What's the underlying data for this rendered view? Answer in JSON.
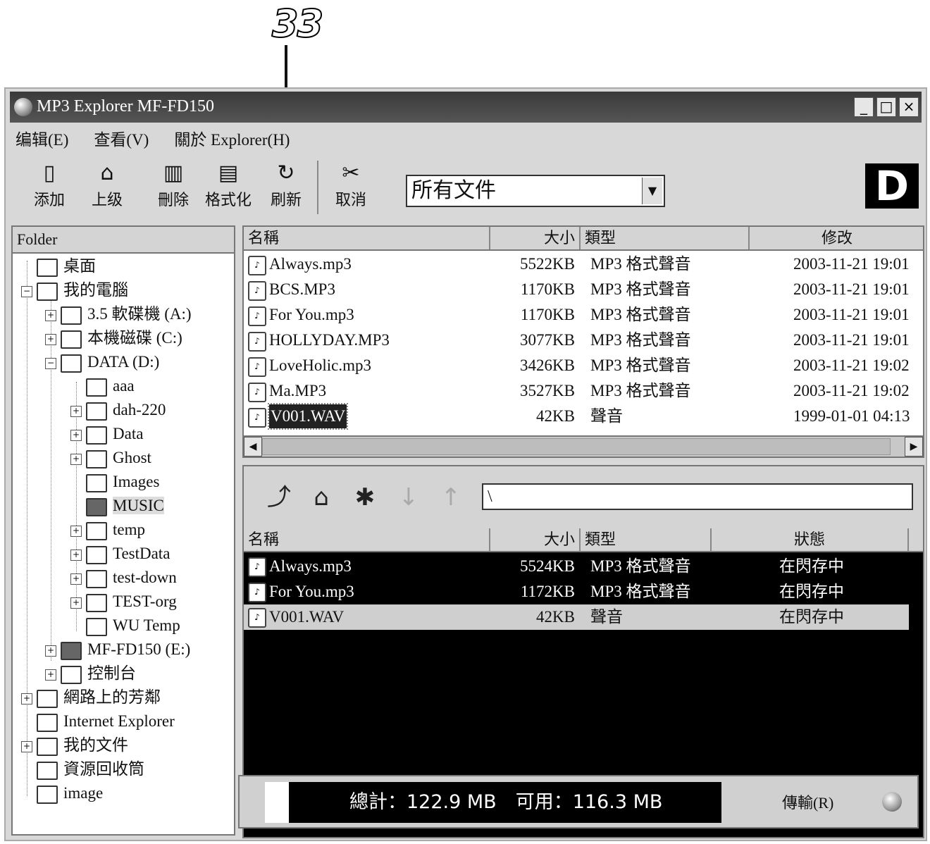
{
  "callout": {
    "number": "33"
  },
  "window": {
    "title": "MP3 Explorer MF-FD150",
    "controls": [
      "_",
      "□",
      "×"
    ]
  },
  "menu": [
    "编辑(E)",
    "查看(V)",
    "關於 Explorer(H)"
  ],
  "toolbar": {
    "buttons": [
      {
        "label": "添加",
        "icon": "add-file-icon"
      },
      {
        "label": "上级",
        "icon": "up-folder-icon"
      },
      {
        "label": "刪除",
        "icon": "trash-icon"
      },
      {
        "label": "格式化",
        "icon": "format-icon"
      },
      {
        "label": "刷新",
        "icon": "refresh-icon"
      },
      {
        "label": "取消",
        "icon": "cancel-icon"
      }
    ],
    "filter_value": "所有文件",
    "logo": "D"
  },
  "folder_pane": {
    "header": "Folder",
    "items": [
      {
        "label": "桌面"
      },
      {
        "label": "我的電腦"
      },
      {
        "label": "3.5 軟碟機 (A:)"
      },
      {
        "label": "本機磁碟 (C:)"
      },
      {
        "label": "DATA (D:)"
      },
      {
        "label": "aaa"
      },
      {
        "label": "dah-220"
      },
      {
        "label": "Data"
      },
      {
        "label": "Ghost"
      },
      {
        "label": "Images"
      },
      {
        "label": "MUSIC"
      },
      {
        "label": "temp"
      },
      {
        "label": "TestData"
      },
      {
        "label": "test-down"
      },
      {
        "label": "TEST-org"
      },
      {
        "label": "WU Temp"
      },
      {
        "label": "MF-FD150 (E:)"
      },
      {
        "label": "控制台"
      },
      {
        "label": "網路上的芳鄰"
      },
      {
        "label": "Internet Explorer"
      },
      {
        "label": "我的文件"
      },
      {
        "label": "資源回收筒"
      },
      {
        "label": "image"
      }
    ]
  },
  "local_files": {
    "columns": [
      "名稱",
      "大小",
      "類型",
      "修改"
    ],
    "rows": [
      {
        "name": "Always.mp3",
        "size": "5522KB",
        "type": "MP3 格式聲音",
        "modified": "2003-11-21 19:01"
      },
      {
        "name": "BCS.MP3",
        "size": "1170KB",
        "type": "MP3 格式聲音",
        "modified": "2003-11-21 19:01"
      },
      {
        "name": "For You.mp3",
        "size": "1170KB",
        "type": "MP3 格式聲音",
        "modified": "2003-11-21 19:01"
      },
      {
        "name": "HOLLYDAY.MP3",
        "size": "3077KB",
        "type": "MP3 格式聲音",
        "modified": "2003-11-21 19:01"
      },
      {
        "name": "LoveHolic.mp3",
        "size": "3426KB",
        "type": "MP3 格式聲音",
        "modified": "2003-11-21 19:02"
      },
      {
        "name": "Ma.MP3",
        "size": "3527KB",
        "type": "MP3 格式聲音",
        "modified": "2003-11-21 19:02"
      },
      {
        "name": "V001.WAV",
        "size": "42KB",
        "type": "聲音",
        "modified": "1999-01-01 04:13"
      }
    ]
  },
  "device": {
    "path": "\\",
    "columns": [
      "名稱",
      "大小",
      "類型",
      "狀態"
    ],
    "rows": [
      {
        "name": "Always.mp3",
        "size": "5524KB",
        "type": "MP3 格式聲音",
        "status": "在閃存中"
      },
      {
        "name": "For You.mp3",
        "size": "1172KB",
        "type": "MP3 格式聲音",
        "status": "在閃存中"
      },
      {
        "name": "V001.WAV",
        "size": "42KB",
        "type": "聲音",
        "status": "在閃存中"
      }
    ]
  },
  "status": {
    "capacity_text": "總計：122.9 MB　可用：116.3 MB",
    "transfer_label": "傳輸(R)"
  }
}
